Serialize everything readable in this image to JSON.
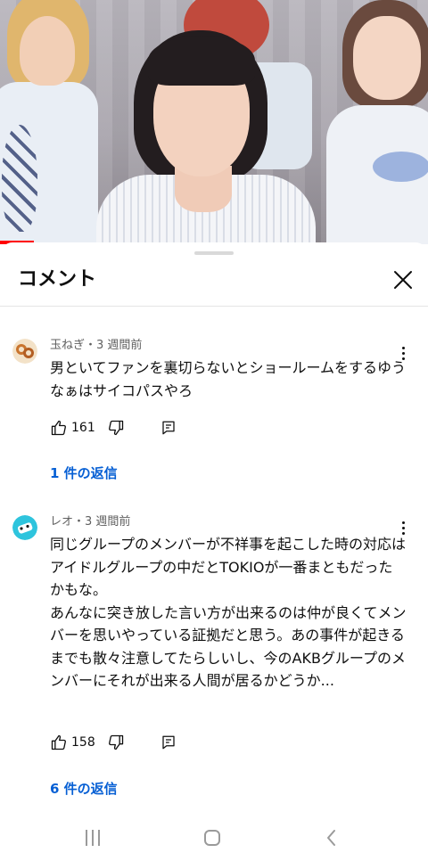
{
  "video": {
    "progress_fraction": 0.08
  },
  "sheet": {
    "title": "コメント"
  },
  "comments": [
    {
      "author_meta": "玉ねぎ・3 週間前",
      "text": "男といてファンを裏切らないとショールームをするゆうなぁはサイコパスやろ",
      "likes": "161",
      "replies_label": "1 件の返信",
      "avatar_color": "#c9742e"
    },
    {
      "author_meta": "レオ・3 週間前",
      "text": "同じグループのメンバーが不祥事を起こした時の対応はアイドルグループの中だとTOKIOが一番まともだったかもな。\nあんなに突き放した言い方が出来るのは仲が良くてメンバーを思いやっている証拠だと思う。あの事件が起きるまでも散々注意してたらしいし、今のAKBグループのメンバーにそれが出来る人間が居るかどうか...",
      "likes": "158",
      "replies_label": "6 件の返信",
      "avatar_color": "#2ec4dd"
    }
  ],
  "colors": {
    "link": "#065fd4",
    "progress": "#ff0000",
    "secondary_text": "#606060"
  },
  "icons": {
    "close": "close-icon",
    "like": "thumb-up-icon",
    "dislike": "thumb-down-icon",
    "reply": "comment-reply-icon",
    "more": "more-vertical-icon",
    "nav_recents": "recent-apps-icon",
    "nav_home": "home-icon",
    "nav_back": "back-icon"
  }
}
